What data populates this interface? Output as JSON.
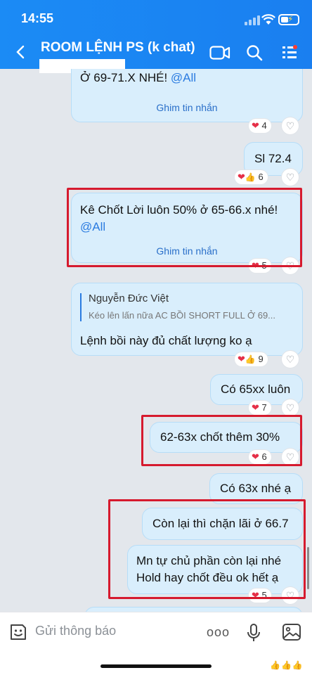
{
  "status": {
    "time": "14:55"
  },
  "header": {
    "title": "ROOM LỆNH PS (k chat)"
  },
  "messages": {
    "m1": {
      "line1": "Ở 69-71.X NHÉ! ",
      "mention": "@All",
      "pin": "Ghim tin nhắn",
      "reactions": "4"
    },
    "m2": {
      "text": "Sl 72.4",
      "reactions": "6"
    },
    "m3": {
      "text": "Kê Chốt Lời luôn 50% ở 65-66.x nhé!",
      "mention": "@All",
      "pin": "Ghim tin nhắn",
      "reactions": "5"
    },
    "m4": {
      "quote_name": "Nguyễn Đức Việt",
      "quote_text": "Kéo lên lấn nữa AC BỒI SHORT FULL Ở 69...",
      "text": "Lệnh bồi này đủ chất lượng ko ạ",
      "reactions": "9"
    },
    "m5": {
      "text": "Có 65xx luôn",
      "reactions": "7"
    },
    "m6": {
      "text": "62-63x chốt thêm 30%",
      "reactions": "6"
    },
    "m7": {
      "text": "Có 63x nhé ạ"
    },
    "m8": {
      "text": "Còn lại thì chặn lãi ở 66.7"
    },
    "m9": {
      "line1": "Mn tự chủ phần còn lại nhé",
      "line2": "Hold hay chốt đều ok hết ạ",
      "reactions": "5"
    }
  },
  "input": {
    "placeholder": "Gửi thông báo",
    "more": "ooo"
  },
  "colors": {
    "header": "#1b8bf5",
    "bubble": "#d9eefc",
    "highlight_box": "#d61a2e"
  }
}
